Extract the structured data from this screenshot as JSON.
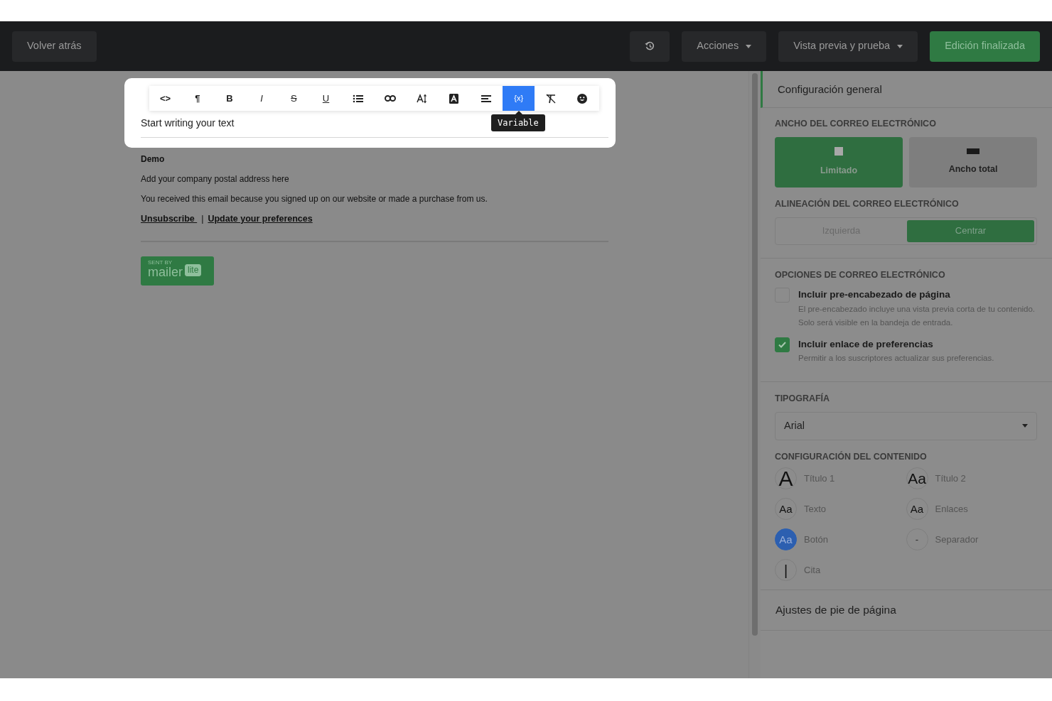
{
  "topbar": {
    "back": "Volver atrás",
    "actions": [
      {
        "label": "Acciones",
        "dropdown": true
      },
      {
        "label": "Vista previa y prueba",
        "dropdown": true
      }
    ],
    "finish": "Edición finalizada"
  },
  "editor": {
    "toolbar": [
      {
        "kind": "glyph",
        "label": "<>",
        "selected": false
      },
      {
        "kind": "glyph",
        "label": "¶",
        "selected": false
      },
      {
        "kind": "bold",
        "label": "B",
        "selected": false
      },
      {
        "kind": "italic",
        "label": "I",
        "selected": false
      },
      {
        "kind": "strike",
        "label": "S",
        "selected": false
      },
      {
        "kind": "underline",
        "label": "U",
        "selected": false
      },
      {
        "kind": "list",
        "selected": false
      },
      {
        "kind": "link",
        "selected": false
      },
      {
        "kind": "fontsize",
        "selected": false
      },
      {
        "kind": "color",
        "selected": false
      },
      {
        "kind": "align",
        "selected": false
      },
      {
        "kind": "glyph",
        "label": "{x}",
        "selected": true
      },
      {
        "kind": "clear",
        "selected": false
      },
      {
        "kind": "emoji",
        "selected": false
      }
    ],
    "tooltip": "Variable",
    "placeholder": "Start writing your text"
  },
  "footer": {
    "company": "Demo",
    "address": "Add your company postal address here",
    "notice": "You received this email because you signed up on our website or made a purchase from us.",
    "links": [
      "Unsubscribe ",
      "Update your preferences"
    ],
    "separator": "|",
    "badge": {
      "sent_by": "SENT BY",
      "word": "mailer",
      "bubble": "lite"
    }
  },
  "panel": {
    "title": "Configuración general",
    "width": {
      "heading": "ANCHO DEL CORREO ELECTRÓNICO",
      "options": [
        {
          "label": "Limitado",
          "kind": "limited",
          "selected": true
        },
        {
          "label": "Ancho total",
          "kind": "full",
          "selected": false
        }
      ]
    },
    "alignment": {
      "heading": "ALINEACIÓN DEL CORREO ELECTRÓNICO",
      "options": [
        {
          "label": "Izquierda",
          "selected": false
        },
        {
          "label": "Centrar",
          "selected": true
        }
      ]
    },
    "options": {
      "heading": "OPCIONES DE CORREO ELECTRÓNICO",
      "items": [
        {
          "label": "Incluir pre-encabezado de página",
          "description": "El pre-encabezado incluye una vista previa corta de tu contenido. Solo será visible en la bandeja de entrada.",
          "checked": false
        },
        {
          "label": "Incluir enlace de preferencias",
          "description": "Permitir a los suscriptores actualizar sus preferencias.",
          "checked": true
        }
      ]
    },
    "typography": {
      "heading": "TIPOGRAFÍA",
      "value": "Arial"
    },
    "content": {
      "heading": "CONFIGURACIÓN DEL CONTENIDO",
      "items": [
        {
          "kind": "heading1",
          "sample": "A",
          "label": "Título 1"
        },
        {
          "kind": "heading2",
          "sample": "Aa",
          "label": "Título 2"
        },
        {
          "kind": "text",
          "sample": "Aa",
          "label": "Texto"
        },
        {
          "kind": "links",
          "sample": "Aa",
          "label": "Enlaces"
        },
        {
          "kind": "button",
          "sample": "Aa",
          "label": "Botón"
        },
        {
          "kind": "separator",
          "sample": "-",
          "label": "Separador"
        },
        {
          "kind": "quote",
          "sample": "|",
          "label": "Cita"
        }
      ]
    },
    "footer_settings": "Ajustes de pie de página"
  }
}
